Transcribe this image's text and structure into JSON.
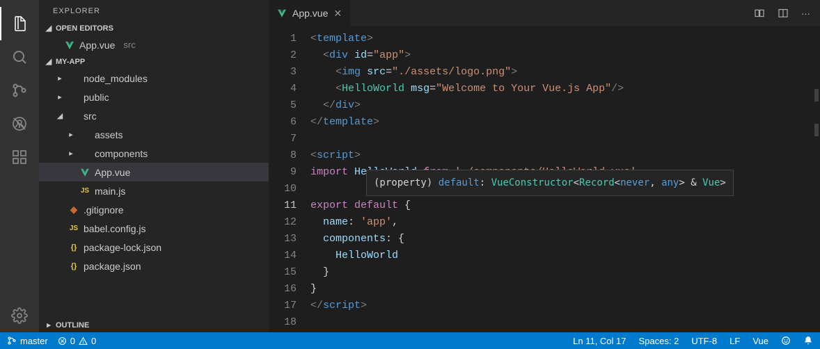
{
  "sidebar": {
    "title": "EXPLORER",
    "sections": {
      "openEditors": {
        "label": "OPEN EDITORS",
        "items": [
          {
            "name": "App.vue",
            "dir": "src"
          }
        ]
      },
      "project": {
        "label": "MY-APP",
        "tree": [
          {
            "label": "node_modules",
            "depth": 1,
            "kind": "folder",
            "expanded": false
          },
          {
            "label": "public",
            "depth": 1,
            "kind": "folder",
            "expanded": false
          },
          {
            "label": "src",
            "depth": 1,
            "kind": "folder",
            "expanded": true
          },
          {
            "label": "assets",
            "depth": 2,
            "kind": "folder",
            "expanded": false
          },
          {
            "label": "components",
            "depth": 2,
            "kind": "folder",
            "expanded": false
          },
          {
            "label": "App.vue",
            "depth": 2,
            "kind": "vue",
            "selected": true
          },
          {
            "label": "main.js",
            "depth": 2,
            "kind": "js"
          },
          {
            "label": ".gitignore",
            "depth": 1,
            "kind": "git"
          },
          {
            "label": "babel.config.js",
            "depth": 1,
            "kind": "js"
          },
          {
            "label": "package-lock.json",
            "depth": 1,
            "kind": "json"
          },
          {
            "label": "package.json",
            "depth": 1,
            "kind": "json"
          }
        ]
      },
      "outline": {
        "label": "OUTLINE"
      }
    }
  },
  "editor": {
    "tab": {
      "name": "App.vue"
    },
    "activeLine": 11,
    "tooltip": {
      "prefix": "(property) ",
      "name": "default",
      "sep": ": ",
      "type1": "VueConstructor",
      "lt": "<",
      "type2": "Record",
      "lt2": "<",
      "never": "never",
      "comma": ", ",
      "any": "any",
      "gt2": ">",
      "amp": " & ",
      "vue": "Vue",
      "gt": ">"
    },
    "lines": [
      {
        "n": 1,
        "tokens": [
          [
            "br",
            "<"
          ],
          [
            "tag",
            "template"
          ],
          [
            "br",
            ">"
          ]
        ]
      },
      {
        "n": 2,
        "tokens": [
          [
            "plain",
            "  "
          ],
          [
            "br",
            "<"
          ],
          [
            "tag",
            "div"
          ],
          [
            "plain",
            " "
          ],
          [
            "attr",
            "id"
          ],
          [
            "plain",
            "="
          ],
          [
            "str",
            "\"app\""
          ],
          [
            "br",
            ">"
          ]
        ]
      },
      {
        "n": 3,
        "tokens": [
          [
            "plain",
            "    "
          ],
          [
            "br",
            "<"
          ],
          [
            "tag",
            "img"
          ],
          [
            "plain",
            " "
          ],
          [
            "attr",
            "src"
          ],
          [
            "plain",
            "="
          ],
          [
            "str",
            "\"./assets/logo.png\""
          ],
          [
            "br",
            ">"
          ]
        ]
      },
      {
        "n": 4,
        "tokens": [
          [
            "plain",
            "    "
          ],
          [
            "br",
            "<"
          ],
          [
            "comp",
            "HelloWorld"
          ],
          [
            "plain",
            " "
          ],
          [
            "attr",
            "msg"
          ],
          [
            "plain",
            "="
          ],
          [
            "str",
            "\"Welcome to Your Vue.js App\""
          ],
          [
            "br",
            "/>"
          ]
        ]
      },
      {
        "n": 5,
        "tokens": [
          [
            "plain",
            "  "
          ],
          [
            "br",
            "</"
          ],
          [
            "tag",
            "div"
          ],
          [
            "br",
            ">"
          ]
        ]
      },
      {
        "n": 6,
        "tokens": [
          [
            "br",
            "</"
          ],
          [
            "tag",
            "template"
          ],
          [
            "br",
            ">"
          ]
        ]
      },
      {
        "n": 7,
        "tokens": []
      },
      {
        "n": 8,
        "tokens": [
          [
            "br",
            "<"
          ],
          [
            "tag",
            "script"
          ],
          [
            "br",
            ">"
          ]
        ]
      },
      {
        "n": 9,
        "tokens": [
          [
            "kw",
            "import"
          ],
          [
            "plain",
            " "
          ],
          [
            "var",
            "HelloWorld"
          ],
          [
            "plain",
            " "
          ],
          [
            "kw",
            "from"
          ],
          [
            "plain",
            " "
          ],
          [
            "str",
            "'./components/HelloWorld.vue'"
          ]
        ]
      },
      {
        "n": 10,
        "tokens": []
      },
      {
        "n": 11,
        "tokens": [
          [
            "kw",
            "export"
          ],
          [
            "plain",
            " "
          ],
          [
            "kw",
            "default"
          ],
          [
            "plain",
            " {"
          ]
        ]
      },
      {
        "n": 12,
        "tokens": [
          [
            "plain",
            "  "
          ],
          [
            "var",
            "name"
          ],
          [
            "plain",
            ": "
          ],
          [
            "str",
            "'app'"
          ],
          [
            "plain",
            ","
          ]
        ]
      },
      {
        "n": 13,
        "tokens": [
          [
            "plain",
            "  "
          ],
          [
            "var",
            "components"
          ],
          [
            "plain",
            ": {"
          ]
        ]
      },
      {
        "n": 14,
        "tokens": [
          [
            "plain",
            "    "
          ],
          [
            "var",
            "HelloWorld"
          ]
        ]
      },
      {
        "n": 15,
        "tokens": [
          [
            "plain",
            "  }"
          ]
        ]
      },
      {
        "n": 16,
        "tokens": [
          [
            "plain",
            "}"
          ]
        ]
      },
      {
        "n": 17,
        "tokens": [
          [
            "br",
            "</"
          ],
          [
            "tag",
            "script"
          ],
          [
            "br",
            ">"
          ]
        ]
      },
      {
        "n": 18,
        "tokens": []
      }
    ]
  },
  "statusbar": {
    "branch": "master",
    "errors": "0",
    "warnings": "0",
    "lnCol": "Ln 11, Col 17",
    "spaces": "Spaces: 2",
    "encoding": "UTF-8",
    "eol": "LF",
    "lang": "Vue"
  }
}
